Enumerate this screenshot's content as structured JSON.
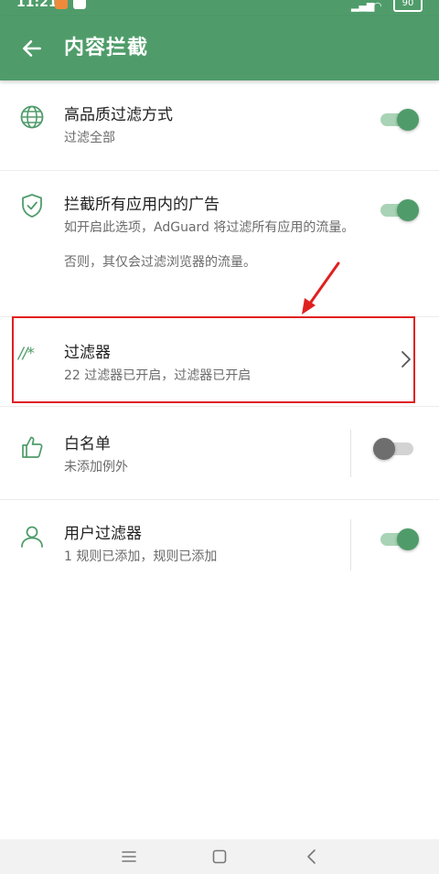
{
  "status_bar": {
    "time": "11:21",
    "battery": "90"
  },
  "app_bar": {
    "title": "内容拦截",
    "back_icon": "arrow-left-icon"
  },
  "settings": [
    {
      "icon": "globe-icon",
      "title": "高品质过滤方式",
      "subtitle": "过滤全部",
      "control": "switch",
      "checked": true
    },
    {
      "icon": "shield-check-icon",
      "title": "拦截所有应用内的广告",
      "subtitle": "如开启此选项，AdGuard 将过滤所有应用的流量。",
      "subtitle2": "否则，其仅会过滤浏览器的流量。",
      "control": "switch",
      "checked": true
    },
    {
      "icon": "filter-slash-asterisk-icon",
      "icon_text": "//*",
      "title": "过滤器",
      "subtitle": "22 过滤器已开启，过滤器已开启",
      "control": "chevron"
    },
    {
      "icon": "thumbs-up-icon",
      "title": "白名单",
      "subtitle": "未添加例外",
      "control": "switch",
      "checked": false
    },
    {
      "icon": "user-icon",
      "title": "用户过滤器",
      "subtitle": "1 规则已添加，规则已添加",
      "control": "switch",
      "checked": true
    }
  ],
  "nav_bar": [
    "menu-icon",
    "home-square-icon",
    "back-triangle-icon"
  ],
  "colors": {
    "primary": "#4f9c6a",
    "switch_track_on": "#a9d3b6",
    "annotation": "#e02020"
  }
}
